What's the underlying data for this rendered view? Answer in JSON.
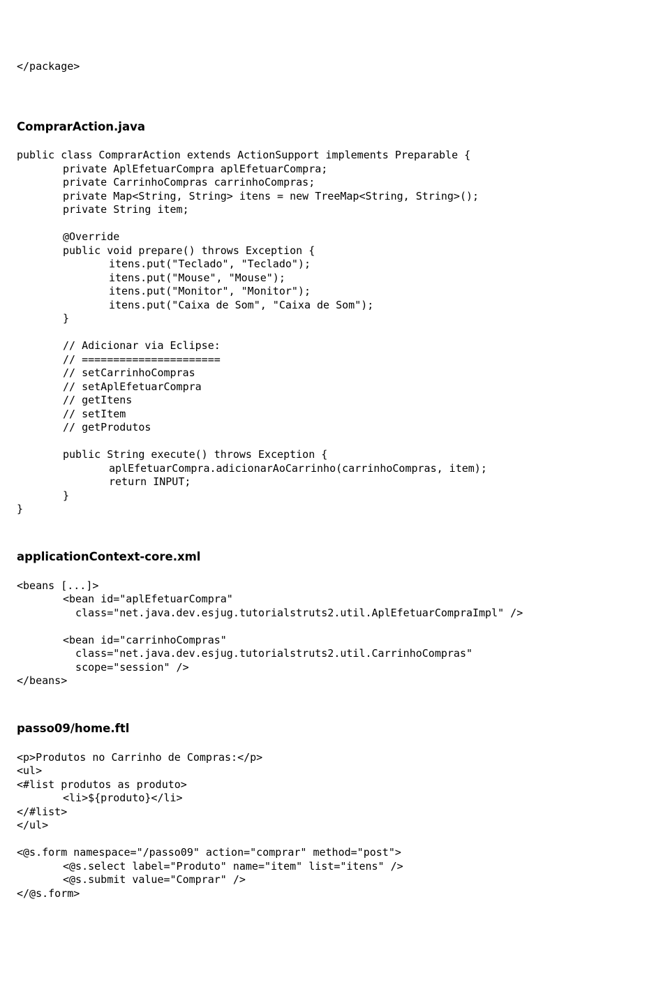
{
  "section0": {
    "line0": "</package>"
  },
  "heading1": "ComprarAction.java",
  "code1": {
    "l0": "public class ComprarAction extends ActionSupport implements Preparable {",
    "l1": "private AplEfetuarCompra aplEfetuarCompra;",
    "l2": "private CarrinhoCompras carrinhoCompras;",
    "l3": "private Map<String, String> itens = new TreeMap<String, String>();",
    "l4": "private String item;",
    "l5": "@Override",
    "l6": "public void prepare() throws Exception {",
    "l7": "itens.put(\"Teclado\", \"Teclado\");",
    "l8": "itens.put(\"Mouse\", \"Mouse\");",
    "l9": "itens.put(\"Monitor\", \"Monitor\");",
    "l10": "itens.put(\"Caixa de Som\", \"Caixa de Som\");",
    "l11": "}",
    "l12": "// Adicionar via Eclipse:",
    "l13": "// ======================",
    "l14": "// setCarrinhoCompras",
    "l15": "// setAplEfetuarCompra",
    "l16": "// getItens",
    "l17": "// setItem",
    "l18": "// getProdutos",
    "l19": "public String execute() throws Exception {",
    "l20": "aplEfetuarCompra.adicionarAoCarrinho(carrinhoCompras, item);",
    "l21": "return INPUT;",
    "l22": "}",
    "l23": "}"
  },
  "heading2": "applicationContext-core.xml",
  "code2": {
    "l0": "<beans [...]>",
    "l1": "<bean id=\"aplEfetuarCompra\"",
    "l2": "  class=\"net.java.dev.esjug.tutorialstruts2.util.AplEfetuarCompraImpl\" />",
    "l3": "<bean id=\"carrinhoCompras\"",
    "l4": "  class=\"net.java.dev.esjug.tutorialstruts2.util.CarrinhoCompras\"",
    "l5": "  scope=\"session\" />",
    "l6": "</beans>"
  },
  "heading3": "passo09/home.ftl",
  "code3": {
    "l0": "<p>Produtos no Carrinho de Compras:</p>",
    "l1": "<ul>",
    "l2": "<#list produtos as produto>",
    "l3": "<li>${produto}</li>",
    "l4": "</#list>",
    "l5": "</ul>",
    "l6": "<@s.form namespace=\"/passo09\" action=\"comprar\" method=\"post\">",
    "l7": "<@s.select label=\"Produto\" name=\"item\" list=\"itens\" />",
    "l8": "<@s.submit value=\"Comprar\" />",
    "l9": "</@s.form>"
  }
}
